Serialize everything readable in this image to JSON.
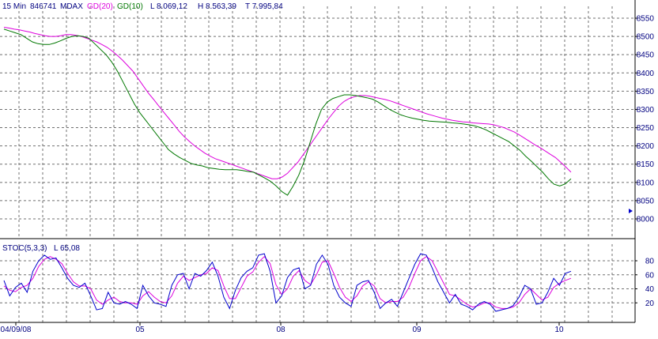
{
  "header": {
    "interval": "15 Min",
    "symbol_code": "846741",
    "symbol": "MDAX",
    "ma20_label": "GD(20)",
    "ma10_label": "GD(10)",
    "low": "L  8.069,12",
    "high": "H  8.563,39",
    "low_day": "T  7.995,84"
  },
  "stoch_header": {
    "name": "STOC(5,3,3)",
    "last": "L  65,08"
  },
  "colors": {
    "candle": "#0000dd",
    "ma20": "#dd00dd",
    "ma10": "#007700",
    "stoch_k": "#0000cc",
    "stoch_d": "#dd00dd",
    "grid": "#707070",
    "background": "#ffffff"
  },
  "chart_data": [
    {
      "type": "line",
      "title": "",
      "x_tick_labels": [
        "04/09/08",
        "05",
        "08",
        "09",
        "10"
      ],
      "y_ticks": [
        8000,
        8050,
        8100,
        8150,
        8200,
        8250,
        8300,
        8350,
        8400,
        8450,
        8500,
        8550
      ],
      "ylim": [
        7985,
        8585
      ],
      "grid": true,
      "series": [
        {
          "name": "GD(20)",
          "values": [
            8525,
            8523,
            8520,
            8518,
            8515,
            8512,
            8508,
            8505,
            8502,
            8500,
            8500,
            8502,
            8505,
            8505,
            8503,
            8500,
            8495,
            8490,
            8485,
            8478,
            8470,
            8460,
            8448,
            8435,
            8420,
            8405,
            8385,
            8365,
            8345,
            8328,
            8310,
            8292,
            8275,
            8258,
            8240,
            8225,
            8212,
            8200,
            8190,
            8180,
            8172,
            8165,
            8160,
            8155,
            8150,
            8145,
            8140,
            8135,
            8130,
            8125,
            8120,
            8115,
            8110,
            8110,
            8115,
            8125,
            8140,
            8155,
            8175,
            8195,
            8215,
            8235,
            8255,
            8275,
            8293,
            8310,
            8322,
            8330,
            8335,
            8338,
            8338,
            8336,
            8333,
            8330,
            8327,
            8323,
            8318,
            8313,
            8308,
            8303,
            8298,
            8293,
            8288,
            8284,
            8280,
            8276,
            8273,
            8270,
            8268,
            8266,
            8265,
            8263,
            8262,
            8261,
            8260,
            8258,
            8254,
            8250,
            8244,
            8238,
            8230,
            8221,
            8212,
            8203,
            8195,
            8186,
            8177,
            8168,
            8155,
            8142,
            8128
          ]
        },
        {
          "name": "GD(10)",
          "values": [
            8520,
            8515,
            8510,
            8505,
            8495,
            8485,
            8480,
            8478,
            8478,
            8482,
            8488,
            8495,
            8500,
            8502,
            8500,
            8495,
            8480,
            8465,
            8450,
            8430,
            8405,
            8375,
            8345,
            8315,
            8290,
            8270,
            8250,
            8230,
            8210,
            8190,
            8178,
            8168,
            8160,
            8152,
            8148,
            8145,
            8140,
            8138,
            8136,
            8135,
            8135,
            8135,
            8133,
            8130,
            8128,
            8120,
            8112,
            8103,
            8090,
            8075,
            8065,
            8090,
            8120,
            8160,
            8210,
            8260,
            8300,
            8320,
            8330,
            8335,
            8340,
            8340,
            8338,
            8335,
            8332,
            8328,
            8320,
            8310,
            8300,
            8292,
            8285,
            8280,
            8276,
            8273,
            8270,
            8268,
            8267,
            8266,
            8265,
            8263,
            8262,
            8260,
            8258,
            8255,
            8250,
            8244,
            8236,
            8228,
            8220,
            8212,
            8200,
            8188,
            8172,
            8158,
            8143,
            8128,
            8110,
            8095,
            8090,
            8096,
            8110
          ]
        }
      ]
    },
    {
      "type": "line",
      "title": "",
      "x_tick_labels": [
        "04/09/08",
        "05",
        "08",
        "09",
        "10"
      ],
      "y_ticks": [
        20,
        40,
        60,
        80
      ],
      "ylim": [
        0,
        100
      ],
      "grid": true,
      "series": [
        {
          "name": "",
          "values": [
            52,
            30,
            42,
            48,
            35,
            65,
            80,
            88,
            82,
            84,
            70,
            55,
            45,
            42,
            48,
            30,
            10,
            12,
            35,
            20,
            18,
            22,
            18,
            12,
            45,
            30,
            20,
            18,
            15,
            45,
            60,
            62,
            40,
            62,
            58,
            66,
            78,
            58,
            28,
            12,
            38,
            56,
            65,
            70,
            88,
            90,
            65,
            20,
            30,
            56,
            67,
            70,
            40,
            45,
            75,
            88,
            75,
            45,
            28,
            20,
            15,
            45,
            50,
            52,
            35,
            12,
            20,
            25,
            15,
            35,
            55,
            75,
            90,
            88,
            70,
            50,
            35,
            20,
            32,
            18,
            15,
            10,
            18,
            22,
            18,
            8,
            10,
            12,
            16,
            28,
            45,
            40,
            18,
            20,
            35,
            55,
            45,
            62,
            65
          ]
        },
        {
          "name": "",
          "values": [
            44,
            38,
            36,
            42,
            45,
            55,
            72,
            82,
            86,
            82,
            76,
            62,
            50,
            44,
            44,
            40,
            24,
            18,
            24,
            28,
            22,
            20,
            20,
            18,
            30,
            36,
            28,
            22,
            20,
            30,
            48,
            58,
            52,
            56,
            60,
            62,
            70,
            66,
            44,
            26,
            26,
            42,
            58,
            64,
            78,
            86,
            76,
            46,
            32,
            40,
            58,
            66,
            52,
            46,
            60,
            78,
            80,
            62,
            42,
            28,
            22,
            30,
            44,
            50,
            44,
            26,
            20,
            22,
            22,
            28,
            42,
            62,
            80,
            86,
            80,
            64,
            48,
            32,
            30,
            24,
            18,
            14,
            16,
            20,
            20,
            14,
            12,
            12,
            14,
            20,
            32,
            40,
            32,
            24,
            28,
            42,
            48,
            52,
            55
          ]
        }
      ]
    }
  ]
}
